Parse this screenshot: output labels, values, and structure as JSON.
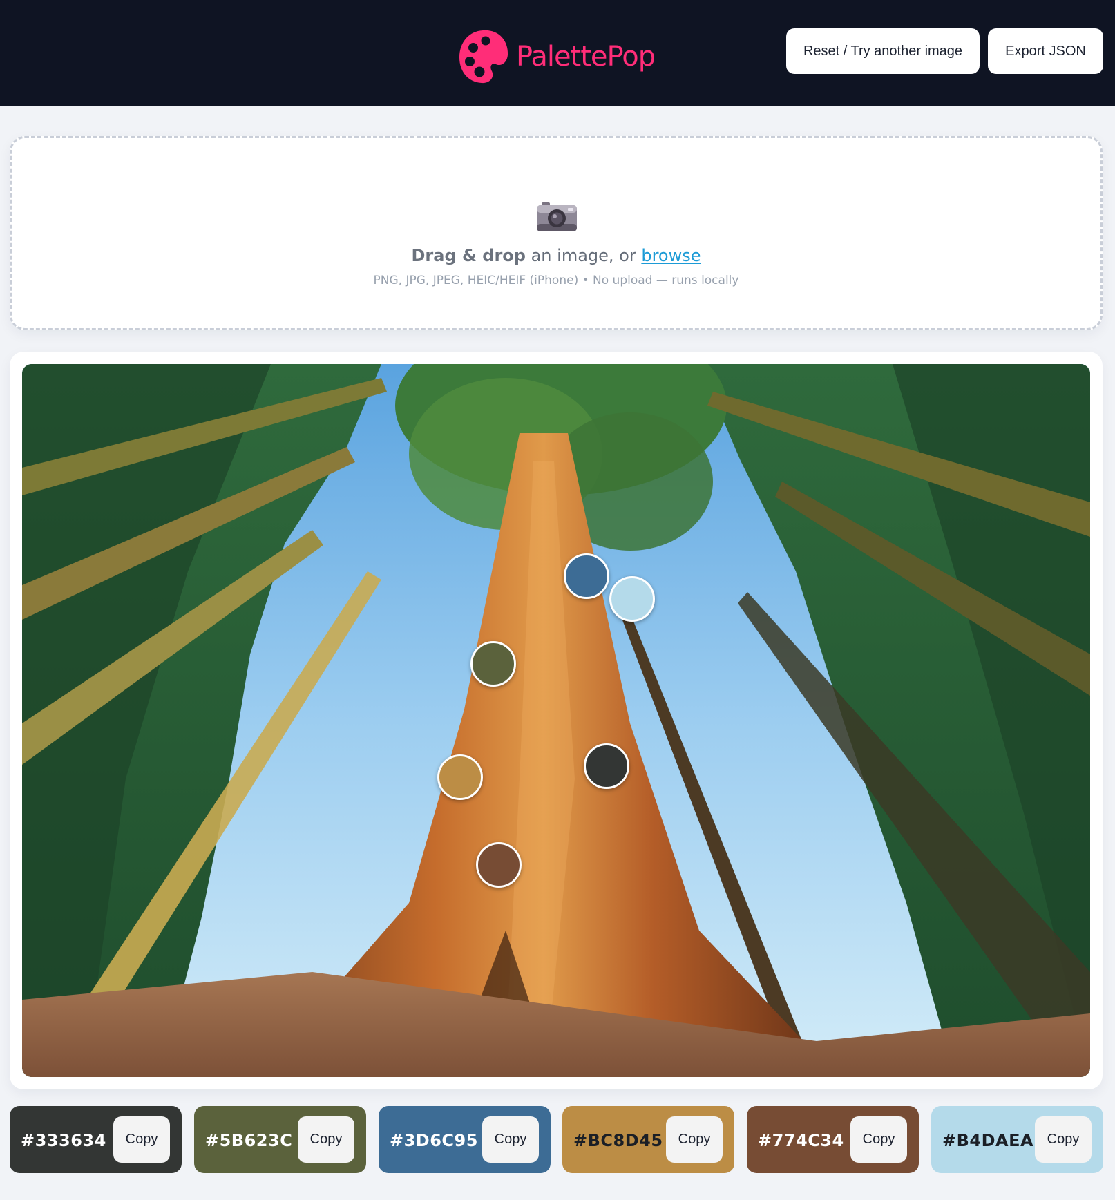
{
  "header": {
    "brand_name": "PalettePop",
    "brand_color": "#ff2d78",
    "reset_label": "Reset / Try another image",
    "export_label": "Export JSON"
  },
  "dropzone": {
    "icon": "camera-icon",
    "bold_text": "Drag & drop",
    "middle_text": " an image, or ",
    "link_text": "browse",
    "subtext": "PNG, JPG, JPEG, HEIC/HEIF (iPhone) • No upload — runs locally"
  },
  "image": {
    "description_icon": "sequoia-forest-photo"
  },
  "palette": [
    {
      "hex": "#333634",
      "color": "#333634",
      "copy_label": "Copy"
    },
    {
      "hex": "#5B623C",
      "color": "#5B623C",
      "copy_label": "Copy"
    },
    {
      "hex": "#3D6C95",
      "color": "#3D6C95",
      "copy_label": "Copy"
    },
    {
      "hex": "#BC8D45",
      "color": "#BC8D45",
      "copy_label": "Copy"
    },
    {
      "hex": "#774C34",
      "color": "#774C34",
      "copy_label": "Copy"
    },
    {
      "hex": "#B4DAEA",
      "color": "#B4DAEA",
      "copy_label": "Copy"
    }
  ]
}
